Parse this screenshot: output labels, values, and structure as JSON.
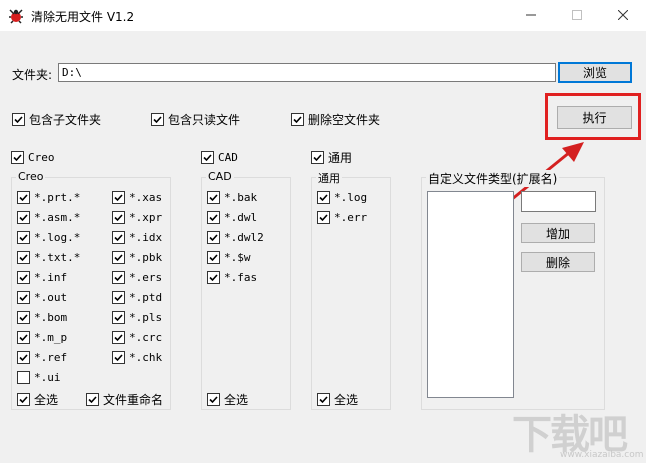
{
  "window": {
    "title": "清除无用文件  V1.2",
    "minimize_icon": "minimize-icon",
    "maximize_icon": "maximize-icon",
    "close_icon": "close-icon"
  },
  "folder": {
    "label": "文件夹:",
    "value": "D:\\",
    "browse_label": "浏览"
  },
  "options": {
    "include_subfolders": "包含子文件夹",
    "include_readonly": "包含只读文件",
    "delete_empty_folders": "删除空文件夹",
    "execute_label": "执行"
  },
  "creo": {
    "enable_label": "Creo",
    "group_title": "Creo",
    "col1": [
      {
        "label": "*.prt.*",
        "checked": true
      },
      {
        "label": "*.asm.*",
        "checked": true
      },
      {
        "label": "*.log.*",
        "checked": true
      },
      {
        "label": "*.txt.*",
        "checked": true
      },
      {
        "label": "*.inf",
        "checked": true
      },
      {
        "label": "*.out",
        "checked": true
      },
      {
        "label": "*.bom",
        "checked": true
      },
      {
        "label": "*.m_p",
        "checked": true
      },
      {
        "label": "*.ref",
        "checked": true
      },
      {
        "label": "*.ui",
        "checked": false
      }
    ],
    "col2": [
      {
        "label": "*.xas",
        "checked": true
      },
      {
        "label": "*.xpr",
        "checked": true
      },
      {
        "label": "*.idx",
        "checked": true
      },
      {
        "label": "*.pbk",
        "checked": true
      },
      {
        "label": "*.ers",
        "checked": true
      },
      {
        "label": "*.ptd",
        "checked": true
      },
      {
        "label": "*.pls",
        "checked": true
      },
      {
        "label": "*.crc",
        "checked": true
      },
      {
        "label": "*.chk",
        "checked": true
      }
    ],
    "select_all": "全选",
    "rename": "文件重命名"
  },
  "cad": {
    "enable_label": "CAD",
    "group_title": "CAD",
    "items": [
      {
        "label": "*.bak",
        "checked": true
      },
      {
        "label": "*.dwl",
        "checked": true
      },
      {
        "label": "*.dwl2",
        "checked": true
      },
      {
        "label": "*.$w",
        "checked": true
      },
      {
        "label": "*.fas",
        "checked": true
      }
    ],
    "select_all": "全选"
  },
  "general": {
    "enable_label": "通用",
    "group_title": "通用",
    "items": [
      {
        "label": "*.log",
        "checked": true
      },
      {
        "label": "*.err",
        "checked": true
      }
    ],
    "select_all": "全选"
  },
  "custom": {
    "title": "自定义文件类型(扩展名)",
    "input_value": "",
    "add_label": "增加",
    "delete_label": "删除"
  },
  "watermark": {
    "text": "下载吧",
    "url": "www.xiazaiba.com"
  },
  "colors": {
    "highlight": "#e02020",
    "arrow": "#d42020",
    "focus": "#0078d7"
  }
}
